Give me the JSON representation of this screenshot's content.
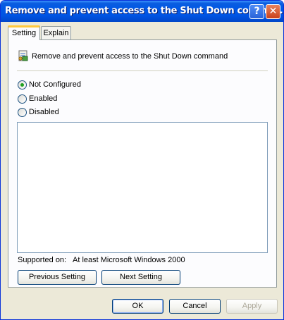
{
  "window": {
    "title": "Remove and prevent access to the Shut Down comma...",
    "help_glyph": "?",
    "close_glyph": "✕"
  },
  "tabs": [
    {
      "label": "Setting",
      "selected": true
    },
    {
      "label": "Explain",
      "selected": false
    }
  ],
  "policy": {
    "icon": "policy-setting-icon",
    "title": "Remove and prevent access to the Shut Down command"
  },
  "options": [
    {
      "label": "Not Configured",
      "checked": true
    },
    {
      "label": "Enabled",
      "checked": false
    },
    {
      "label": "Disabled",
      "checked": false
    }
  ],
  "supported": {
    "label": "Supported on:",
    "value": "At least Microsoft Windows 2000"
  },
  "nav_buttons": {
    "previous": "Previous Setting",
    "next": "Next Setting"
  },
  "dialog_buttons": {
    "ok": "OK",
    "cancel": "Cancel",
    "apply": "Apply",
    "apply_disabled": true
  },
  "colors": {
    "title_bar": "#0054e3",
    "dialog_bg": "#ece9d8",
    "tab_accent": "#ffc83c",
    "radio_dot": "#21a121",
    "close_button": "#c9411b"
  }
}
